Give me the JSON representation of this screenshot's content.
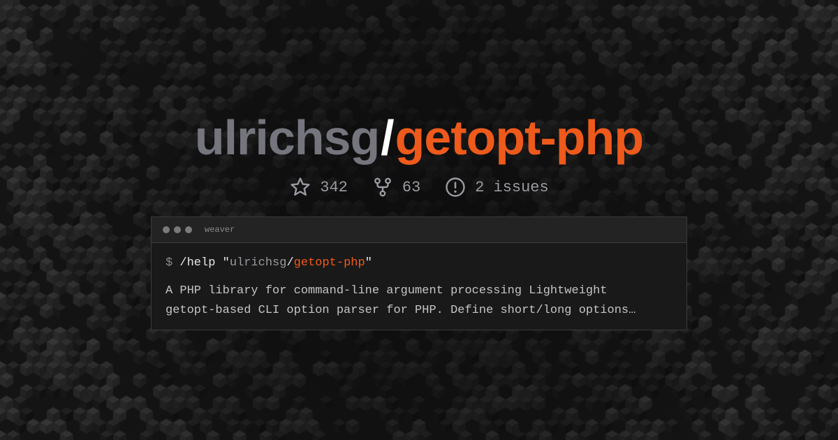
{
  "repo": {
    "owner": "ulrichsg",
    "separator": "/",
    "name": "getopt-php"
  },
  "stats": {
    "stars": {
      "icon": "star-icon",
      "value": "342"
    },
    "forks": {
      "icon": "fork-icon",
      "value": "63"
    },
    "issues": {
      "icon": "issue-icon",
      "value": "2",
      "label": "issues"
    }
  },
  "terminal": {
    "title": "weaver",
    "prompt": "$",
    "command": "/help",
    "quote": "\"",
    "owner": "ulrichsg",
    "separator": "/",
    "repo": "getopt-php",
    "description_lines": [
      "A PHP library for command-line argument processing Lightweight",
      "getopt-based CLI option parser for PHP. Define short/long options…"
    ]
  },
  "colors": {
    "accent": "#ee5a1b",
    "owner": "#75757d",
    "background": "#141414"
  }
}
